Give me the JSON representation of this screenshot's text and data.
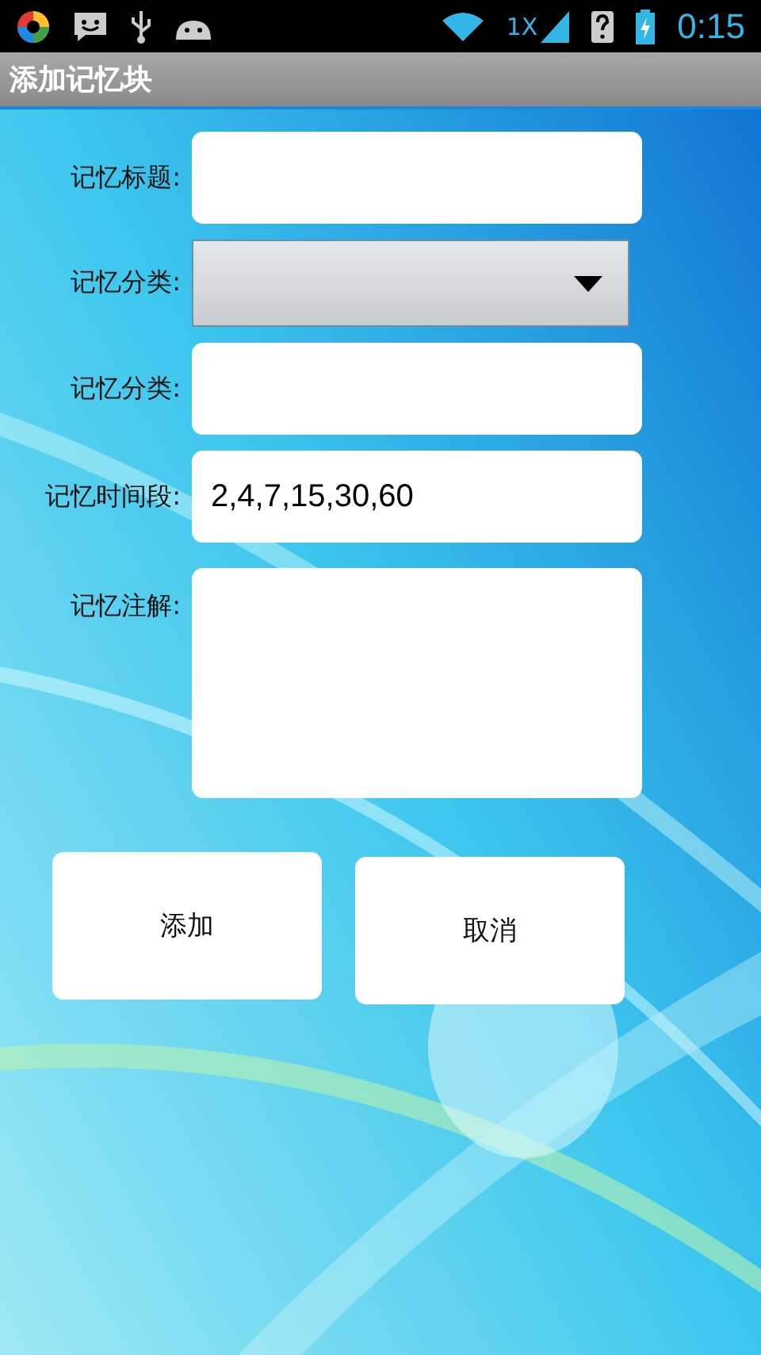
{
  "status_bar": {
    "network": "1X",
    "time": "0:15"
  },
  "title": "添加记忆块",
  "fields": [
    {
      "label": "记忆标题:",
      "kind": "text"
    },
    {
      "label": "记忆分类:",
      "kind": "spinner"
    },
    {
      "label": "记忆分类:",
      "kind": "text"
    },
    {
      "label": "记忆时间段:",
      "kind": "text",
      "value": "2,4,7,15,30,60"
    },
    {
      "label": "记忆注解:",
      "kind": "textarea"
    }
  ],
  "buttons": [
    "添加",
    "取消"
  ]
}
